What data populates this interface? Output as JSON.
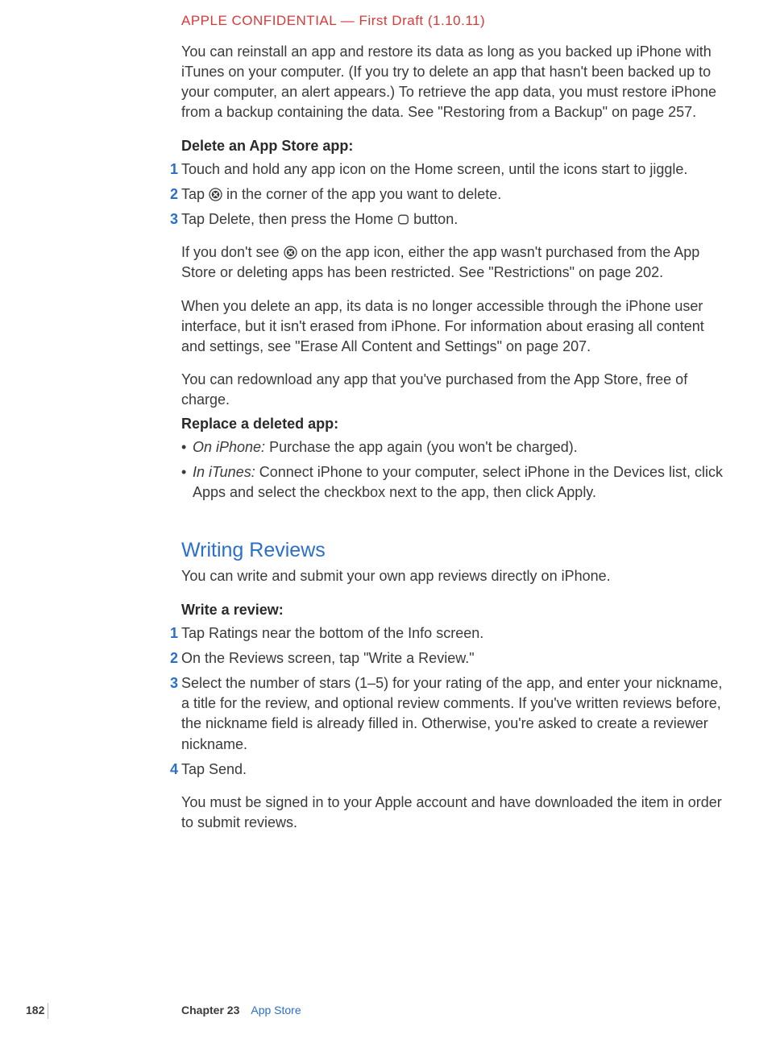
{
  "header": {
    "confidential": "APPLE CONFIDENTIAL — First Draft (1.10.11)"
  },
  "body": {
    "intro_para": "You can reinstall an app and restore its data as long as you backed up iPhone with iTunes on your computer. (If you try to delete an app that hasn't been backed up to your computer, an alert appears.) To retrieve the app data, you must restore iPhone from a backup containing the data. See \"Restoring from a Backup\" on page 257.",
    "delete_head": "Delete an App Store app:",
    "delete_steps": [
      "Touch and hold any app icon on the Home screen, until the icons start to jiggle.",
      "Tap [X] in the corner of the app you want to delete.",
      "Tap Delete, then press the Home [□] button."
    ],
    "delete_step2_before": "Tap ",
    "delete_step2_after": " in the corner of the app you want to delete.",
    "delete_step3_before": "Tap Delete, then press the Home ",
    "delete_step3_after": " button.",
    "no_x_before": "If you don't see ",
    "no_x_after": " on the app icon, either the app wasn't purchased from the App Store or deleting apps has been restricted. See \"Restrictions\" on page 202.",
    "delete_data_para": "When you delete an app, its data is no longer accessible through the iPhone user interface, but it isn't erased from iPhone. For information about erasing all content and settings, see \"Erase All Content and Settings\" on page 207.",
    "redownload_para": "You can redownload any app that you've purchased from the App Store, free of charge.",
    "replace_head": "Replace a deleted app:",
    "replace_bullets": [
      {
        "lead": "On iPhone:",
        "text": " Purchase the app again (you won't be charged)."
      },
      {
        "lead": "In iTunes:",
        "text": " Connect iPhone to your computer, select iPhone in the Devices list, click Apps and select the checkbox next to the app, then click Apply."
      }
    ],
    "reviews_head": "Writing Reviews",
    "reviews_intro": "You can write and submit your own app reviews directly on iPhone.",
    "write_head": "Write a review:",
    "write_steps": [
      "Tap Ratings near the bottom of the Info screen.",
      "On the Reviews screen, tap \"Write a Review.\"",
      "Select the number of stars (1–5) for your rating of the app, and enter your nickname, a title for the review, and optional review comments. If you've written reviews before, the nickname field is already filled in. Otherwise, you're asked to create a reviewer nickname.",
      "Tap Send."
    ],
    "signin_para": "You must be signed in to your Apple account and have downloaded the item in order to submit reviews."
  },
  "footer": {
    "page_num": "182",
    "chapter_label": "Chapter 23",
    "chapter_name": "App Store"
  }
}
